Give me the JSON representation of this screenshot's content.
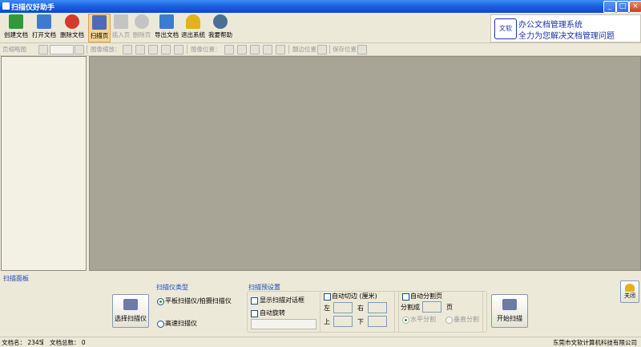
{
  "window": {
    "title": "扫描仪好助手",
    "controls": [
      "_",
      "□",
      "×"
    ]
  },
  "toolbar": {
    "buttons": [
      {
        "label": "创建文档",
        "icon": "new-document-icon",
        "color": "#2E9A3A",
        "enabled": true
      },
      {
        "label": "打开文档",
        "icon": "open-document-icon",
        "color": "#3C7BD1",
        "enabled": true
      },
      {
        "label": "删除文档",
        "icon": "delete-document-icon",
        "color": "#D63A2A",
        "enabled": true
      },
      {
        "label": "扫描页",
        "icon": "scan-page-icon",
        "color": "#4C6BB8",
        "enabled": true,
        "active": true
      },
      {
        "label": "插入页",
        "icon": "insert-page-icon",
        "color": "#B8B8B8",
        "enabled": false
      },
      {
        "label": "删除页",
        "icon": "delete-page-icon",
        "color": "#B8B8B8",
        "enabled": false
      },
      {
        "label": "导出文档",
        "icon": "export-document-icon",
        "color": "#3C7BD1",
        "enabled": true
      },
      {
        "label": "退出系统",
        "icon": "exit-icon",
        "color": "#E3B21B",
        "enabled": true
      },
      {
        "label": "我要帮助",
        "icon": "help-icon",
        "color": "#4A6F96",
        "enabled": true
      }
    ]
  },
  "banner": {
    "line1": "办公文档管理系统",
    "line2": "全力为您解决文档管理问题",
    "logo": "文软"
  },
  "toolbar2": {
    "thumbnail_label": "页缩略图",
    "zoom_label": "图像缩放：",
    "position_label": "图像位置：",
    "crop_label": "翻边位置",
    "save_label": "保存位置"
  },
  "panel": {
    "title": "扫描面板",
    "select_scanner": "选择扫描仪",
    "scanner_type": {
      "title": "扫描仪类型",
      "options": [
        "平板扫描仪/拍摄扫描仪",
        "高速扫描仪"
      ],
      "selected": 0
    },
    "scan_settings": {
      "title": "扫描预设置",
      "show_dialog": "显示扫描对话框",
      "auto_rotate": "自动旋转",
      "auto_crop": "自动切边 (厘米)",
      "left": "左",
      "right": "右",
      "top": "上",
      "bottom": "下",
      "auto_split": "自动分割页",
      "split_count_label": "分割成",
      "page_unit": "页",
      "horizontal_split": "水平分割",
      "vertical_split": "垂直分割"
    },
    "start_scan": "开始扫描",
    "close": "关闭"
  },
  "status": {
    "doc_name": "文档名： 2345",
    "doc_total": "文档总数： 0",
    "company": "东莞市文软计算机科技有限公司"
  }
}
